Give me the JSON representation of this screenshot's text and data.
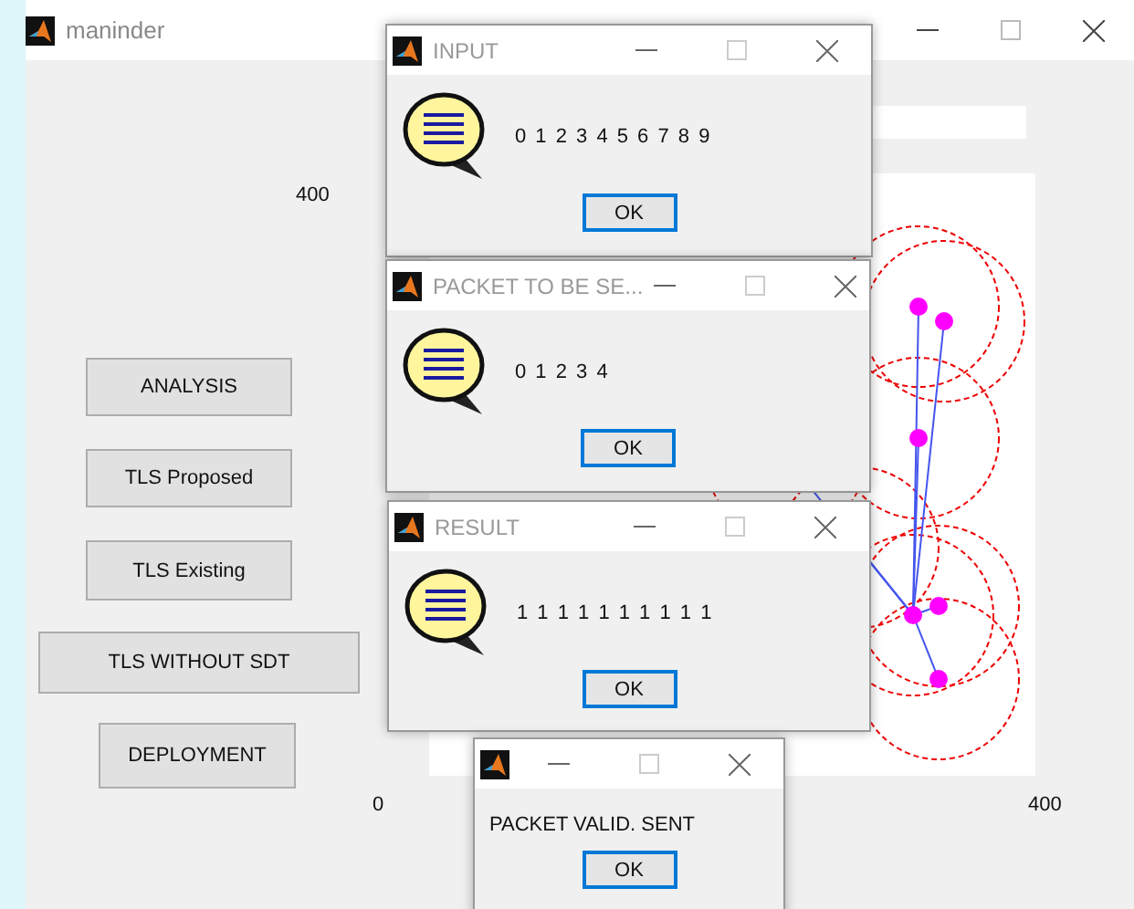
{
  "main_window": {
    "title": "maninder"
  },
  "plot": {
    "y_tick": "400",
    "x_ticks": [
      "0",
      "400"
    ]
  },
  "buttons": [
    "ANALYSIS",
    "TLS Proposed",
    "TLS Existing",
    "TLS WITHOUT SDT",
    "DEPLOYMENT"
  ],
  "dialogs": [
    {
      "kind": "icon",
      "title": "INPUT",
      "message": "0 1 2 3 4 5 6 7 8 9",
      "ok": "OK"
    },
    {
      "kind": "icon",
      "title": "PACKET TO BE SE...",
      "message": "0 1 2 3 4",
      "ok": "OK"
    },
    {
      "kind": "icon",
      "title": "RESULT",
      "message": "1 1 1 1 1 1 1 1 1 1",
      "ok": "OK"
    },
    {
      "kind": "plain",
      "message": "PACKET VALID. SENT",
      "ok": "OK"
    }
  ]
}
